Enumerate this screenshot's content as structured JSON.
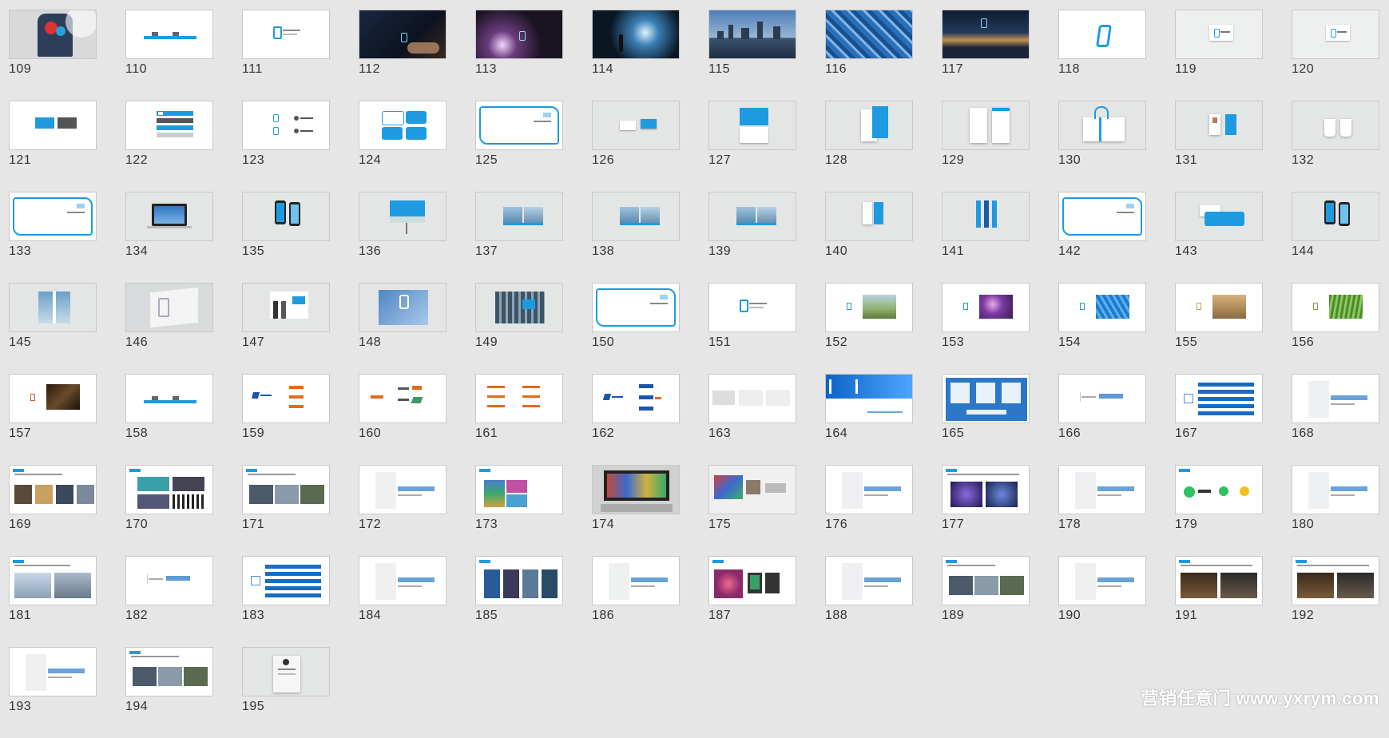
{
  "slide_sorter": {
    "slides": [
      {
        "num": "109",
        "theme": "photo-shirt"
      },
      {
        "num": "110",
        "theme": "white-sign"
      },
      {
        "num": "111",
        "theme": "white-logo"
      },
      {
        "num": "112",
        "theme": "dark-hand"
      },
      {
        "num": "113",
        "theme": "dark-light"
      },
      {
        "num": "114",
        "theme": "dark-person"
      },
      {
        "num": "115",
        "theme": "city-dusk"
      },
      {
        "num": "116",
        "theme": "blue-building"
      },
      {
        "num": "117",
        "theme": "city-night"
      },
      {
        "num": "118",
        "theme": "white-bigmark"
      },
      {
        "num": "119",
        "theme": "gray-logo"
      },
      {
        "num": "120",
        "theme": "gray-logo"
      },
      {
        "num": "121",
        "theme": "white-cards"
      },
      {
        "num": "122",
        "theme": "white-bars"
      },
      {
        "num": "123",
        "theme": "white-logos"
      },
      {
        "num": "124",
        "theme": "white-frames"
      },
      {
        "num": "125",
        "theme": "section-frame"
      },
      {
        "num": "126",
        "theme": "gray-card"
      },
      {
        "num": "127",
        "theme": "gray-envelope"
      },
      {
        "num": "128",
        "theme": "gray-folder"
      },
      {
        "num": "129",
        "theme": "gray-papers"
      },
      {
        "num": "130",
        "theme": "gray-bag"
      },
      {
        "num": "131",
        "theme": "gray-badge"
      },
      {
        "num": "132",
        "theme": "gray-cups"
      },
      {
        "num": "133",
        "theme": "section-frame"
      },
      {
        "num": "134",
        "theme": "gray-laptop"
      },
      {
        "num": "135",
        "theme": "gray-phones"
      },
      {
        "num": "136",
        "theme": "gray-billboard"
      },
      {
        "num": "137",
        "theme": "gray-brochure"
      },
      {
        "num": "138",
        "theme": "gray-brochure"
      },
      {
        "num": "139",
        "theme": "gray-brochure"
      },
      {
        "num": "140",
        "theme": "gray-stand"
      },
      {
        "num": "141",
        "theme": "gray-banners"
      },
      {
        "num": "142",
        "theme": "section-frame"
      },
      {
        "num": "143",
        "theme": "gray-shapes"
      },
      {
        "num": "144",
        "theme": "gray-phones"
      },
      {
        "num": "145",
        "theme": "gray-room"
      },
      {
        "num": "146",
        "theme": "gray-wall"
      },
      {
        "num": "147",
        "theme": "gray-people"
      },
      {
        "num": "148",
        "theme": "blue-photo"
      },
      {
        "num": "149",
        "theme": "gray-facade"
      },
      {
        "num": "150",
        "theme": "section-frame"
      },
      {
        "num": "151",
        "theme": "white-logo"
      },
      {
        "num": "152",
        "theme": "white-photo-tree"
      },
      {
        "num": "153",
        "theme": "white-photo-purple"
      },
      {
        "num": "154",
        "theme": "white-photo-blue"
      },
      {
        "num": "155",
        "theme": "white-photo-class"
      },
      {
        "num": "156",
        "theme": "white-photo-green"
      },
      {
        "num": "157",
        "theme": "white-photo-dark"
      },
      {
        "num": "158",
        "theme": "white-sign"
      },
      {
        "num": "159",
        "theme": "white-brandlogos"
      },
      {
        "num": "160",
        "theme": "white-brandlogos2"
      },
      {
        "num": "161",
        "theme": "white-brandlist"
      },
      {
        "num": "162",
        "theme": "white-order"
      },
      {
        "num": "163",
        "theme": "white-3cards"
      },
      {
        "num": "164",
        "theme": "section-03"
      },
      {
        "num": "165",
        "theme": "blue-table"
      },
      {
        "num": "166",
        "theme": "white-title"
      },
      {
        "num": "167",
        "theme": "white-list"
      },
      {
        "num": "168",
        "theme": "white-chapter"
      },
      {
        "num": "169",
        "theme": "white-4photos"
      },
      {
        "num": "170",
        "theme": "white-4photos-b"
      },
      {
        "num": "171",
        "theme": "white-3photos"
      },
      {
        "num": "172",
        "theme": "white-chapter"
      },
      {
        "num": "173",
        "theme": "white-colorful"
      },
      {
        "num": "174",
        "theme": "gray-screen"
      },
      {
        "num": "175",
        "theme": "white-gallery"
      },
      {
        "num": "176",
        "theme": "white-chapter"
      },
      {
        "num": "177",
        "theme": "white-stage"
      },
      {
        "num": "178",
        "theme": "white-chapter"
      },
      {
        "num": "179",
        "theme": "white-icons"
      },
      {
        "num": "180",
        "theme": "white-chapter"
      },
      {
        "num": "181",
        "theme": "white-2photos"
      },
      {
        "num": "182",
        "theme": "white-title"
      },
      {
        "num": "183",
        "theme": "white-list"
      },
      {
        "num": "184",
        "theme": "white-chapter"
      },
      {
        "num": "185",
        "theme": "white-4vertical"
      },
      {
        "num": "186",
        "theme": "white-chapter"
      },
      {
        "num": "187",
        "theme": "white-crowd"
      },
      {
        "num": "188",
        "theme": "white-chapter"
      },
      {
        "num": "189",
        "theme": "white-3photos"
      },
      {
        "num": "190",
        "theme": "white-chapter"
      },
      {
        "num": "191",
        "theme": "white-dark2"
      },
      {
        "num": "192",
        "theme": "white-dark2"
      },
      {
        "num": "193",
        "theme": "white-chapter"
      },
      {
        "num": "194",
        "theme": "white-3photos"
      },
      {
        "num": "195",
        "theme": "gray-paper"
      }
    ]
  },
  "watermark": "营销任意门 www.yxrym.com",
  "colors": {
    "accent_blue": "#1e9be0",
    "deep_blue": "#1a6cc0",
    "background": "#e6e6e6",
    "thumb_border": "#c8c8c8"
  }
}
